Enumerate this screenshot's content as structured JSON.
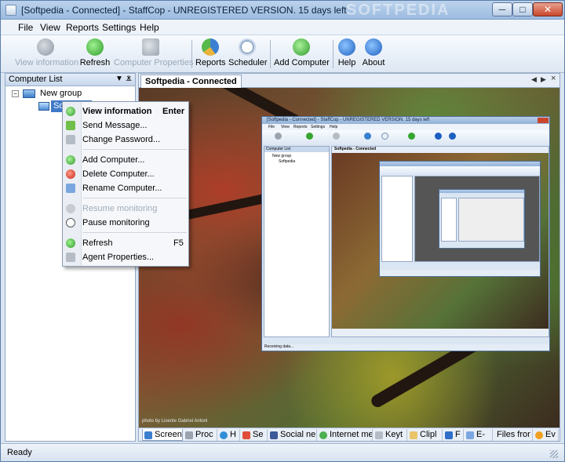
{
  "window": {
    "title": "[Softpedia - Connected] - StaffCop - UNREGISTERED VERSION. 15 days left",
    "watermark": "SOFTPEDIA",
    "minimize_label": "─",
    "maximize_label": "□",
    "close_label": "✕"
  },
  "menu": [
    "File",
    "View",
    "Reports",
    "Settings",
    "Help"
  ],
  "toolbar": {
    "view_information": "View information",
    "refresh": "Refresh",
    "computer_properties": "Computer Properties",
    "reports": "Reports",
    "scheduler": "Scheduler",
    "add_computer": "Add Computer",
    "help": "Help",
    "about": "About"
  },
  "left_panel": {
    "title": "Computer List",
    "pin": "▼ ⊥",
    "close": "×",
    "group": "New group",
    "computer": "Softpedia",
    "expander": "−"
  },
  "right_panel": {
    "tab": "Softpedia - Connected",
    "nav_prev": "◀",
    "nav_next": "▶",
    "nav_close": "×",
    "photo_credit": "photo by Lisente Gabriel Antoni"
  },
  "nested_screen": {
    "title": "[Softpedia - Connected] - StaffCop - UNREGISTERED VERSION. 15 days left",
    "menu": [
      "File",
      "View",
      "Reports",
      "Settings",
      "Help"
    ],
    "panel_title": "Computer List",
    "group": "New group",
    "computer": "Softpedia",
    "tab": "Softpedia - Connected",
    "status": "Receiving data..."
  },
  "bottom_tabs": [
    "Screen",
    "Proc",
    "H",
    "Se",
    "Social ne",
    "Internet me",
    "Keyt",
    "Clipl",
    "F",
    "E-",
    "Files fror",
    "Ev"
  ],
  "context_menu": {
    "view_information": "View information",
    "view_information_shortcut": "Enter",
    "send_message": "Send Message...",
    "change_password": "Change Password...",
    "add_computer": "Add Computer...",
    "delete_computer": "Delete Computer...",
    "rename_computer": "Rename Computer...",
    "resume_monitoring": "Resume monitoring",
    "pause_monitoring": "Pause monitoring",
    "refresh": "Refresh",
    "refresh_shortcut": "F5",
    "agent_properties": "Agent Properties..."
  },
  "status": "Ready",
  "colors": {
    "accent": "#3f79c8",
    "title_bar": "#9cbbe0",
    "close_button": "#c9462b"
  }
}
